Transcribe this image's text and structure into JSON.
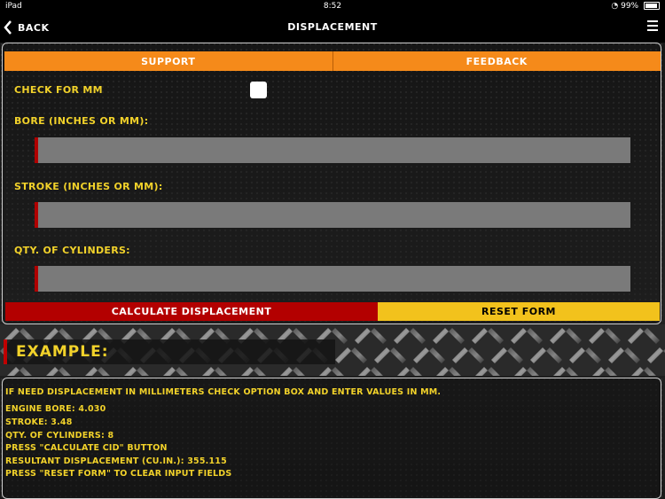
{
  "status_bar": {
    "carrier": "iPad",
    "time": "8:52",
    "battery": "99%"
  },
  "nav": {
    "back_label": "BACK",
    "title": "DISPLACEMENT"
  },
  "top_buttons": {
    "support": "SUPPORT",
    "feedback": "FEEDBACK"
  },
  "form": {
    "check_mm_label": "CHECK FOR MM",
    "check_mm_checked": false,
    "bore_label": "BORE (INCHES OR MM):",
    "bore_value": "",
    "stroke_label": "STROKE (INCHES OR MM):",
    "stroke_value": "",
    "cylinders_label": "QTY. OF CYLINDERS:",
    "cylinders_value": "",
    "calculate_label": "CALCULATE DISPLACEMENT",
    "reset_label": "RESET FORM"
  },
  "example": {
    "title": "EXAMPLE:",
    "lines": [
      "IF NEED DISPLACEMENT IN MILLIMETERS CHECK OPTION BOX AND ENTER VALUES IN MM.",
      "ENGINE BORE: 4.030",
      "STROKE: 3.48",
      "QTY. OF CYLINDERS: 8",
      "PRESS \"CALCULATE CID\" BUTTON",
      "RESULTANT DISPLACEMENT (CU.IN.): 355.115",
      "PRESS \"RESET FORM\" TO CLEAR INPUT FIELDS"
    ]
  },
  "colors": {
    "accent_orange": "#f58a1a",
    "calculate_red": "#b30000",
    "reset_yellow": "#f2c21c",
    "label_yellow": "#f2d22a"
  }
}
